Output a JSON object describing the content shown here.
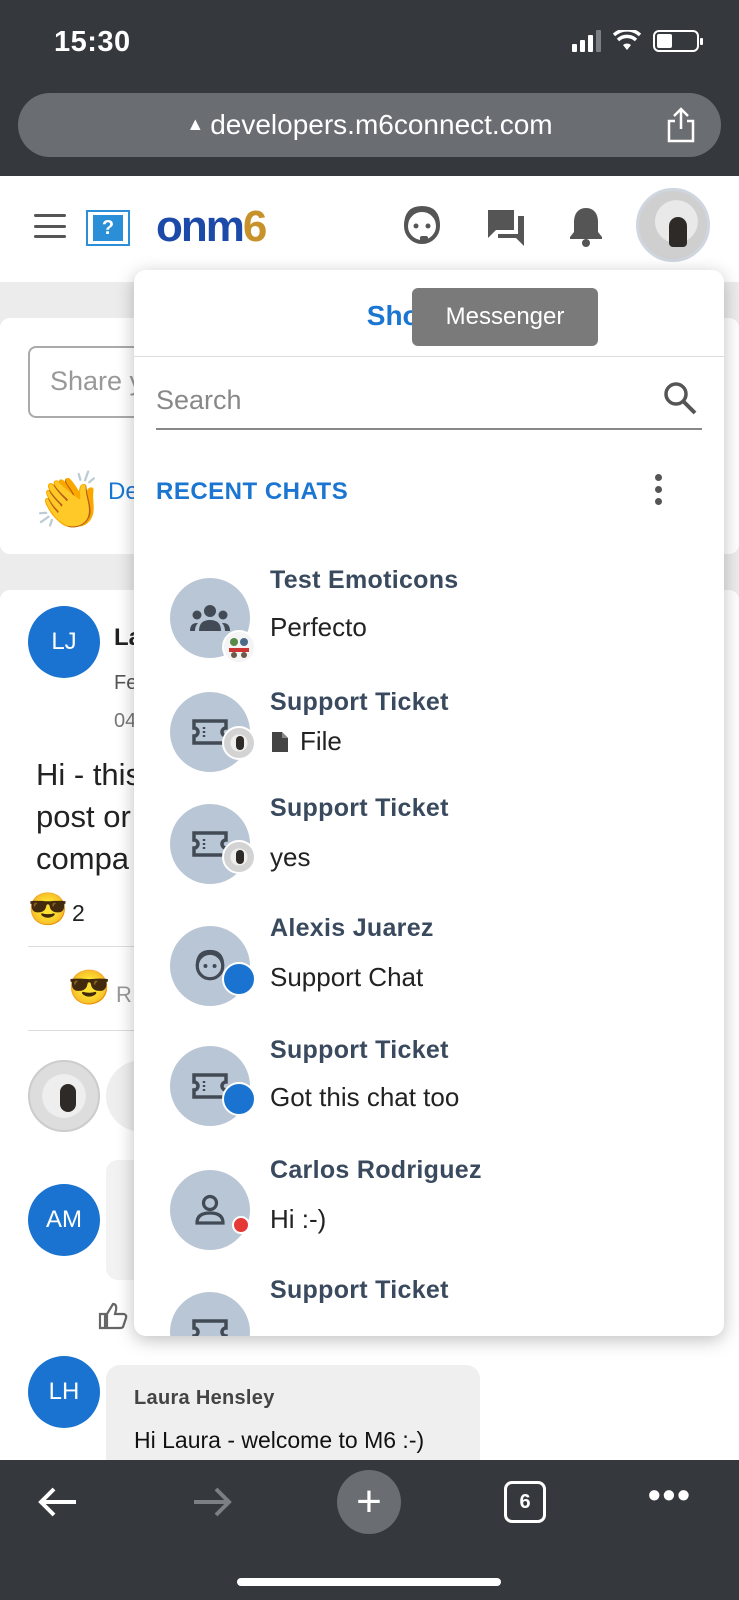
{
  "status_bar": {
    "time": "15:30"
  },
  "browser": {
    "url": "developers.m6connect.com",
    "tab_count": "6"
  },
  "header": {
    "help_label": "?",
    "logo_part1": "onm",
    "logo_part2": "6",
    "icons": [
      "menu-icon",
      "help-icon",
      "support-agent-icon",
      "forum-icon",
      "bell-icon",
      "profile-avatar"
    ]
  },
  "feed": {
    "share_placeholder": "Share y",
    "clap_emoji": "👏",
    "clap_text": "De",
    "post": {
      "author_initials": "LJ",
      "author_name": "La",
      "date_line": "Fe",
      "time_line": "04",
      "body_lines": [
        "Hi - this",
        "post or",
        "compa"
      ],
      "reaction_emoji": "😎",
      "reaction_count": "2",
      "react_button_text": "R"
    },
    "comments": [
      {
        "initials": "AM"
      },
      {
        "initials": "LH",
        "name": "Laura Hensley",
        "text": "Hi Laura - welcome to M6 :-)"
      }
    ]
  },
  "messenger": {
    "show_full_label": "Show full",
    "tooltip": "Messenger",
    "search_placeholder": "Search",
    "recent_heading": "RECENT CHATS",
    "chats": [
      {
        "title": "Test Emoticons",
        "subtitle": "Perfecto",
        "icon": "group-icon",
        "badge": "group-photo"
      },
      {
        "title": "Support Ticket",
        "subtitle": "File",
        "icon": "ticket-icon",
        "badge": "photo",
        "subtitle_icon": "file-icon"
      },
      {
        "title": "Support Ticket",
        "subtitle": "yes",
        "icon": "ticket-icon",
        "badge": "photo"
      },
      {
        "title": "Alexis Juarez",
        "subtitle": "Support Chat",
        "icon": "support-agent-icon",
        "badge": "blue"
      },
      {
        "title": "Support Ticket",
        "subtitle": "Got this chat too",
        "icon": "ticket-icon",
        "badge": "blue"
      },
      {
        "title": "Carlos Rodriguez",
        "subtitle": "Hi :-)",
        "icon": "person-icon",
        "badge": "red"
      },
      {
        "title": "Support Ticket",
        "subtitle": "",
        "icon": "ticket-icon",
        "badge": "none"
      }
    ]
  },
  "colors": {
    "accent_blue": "#1b76d2",
    "chrome_dark": "#35383c",
    "avatar_bg": "#b8c6d6",
    "status_red": "#e53935"
  }
}
